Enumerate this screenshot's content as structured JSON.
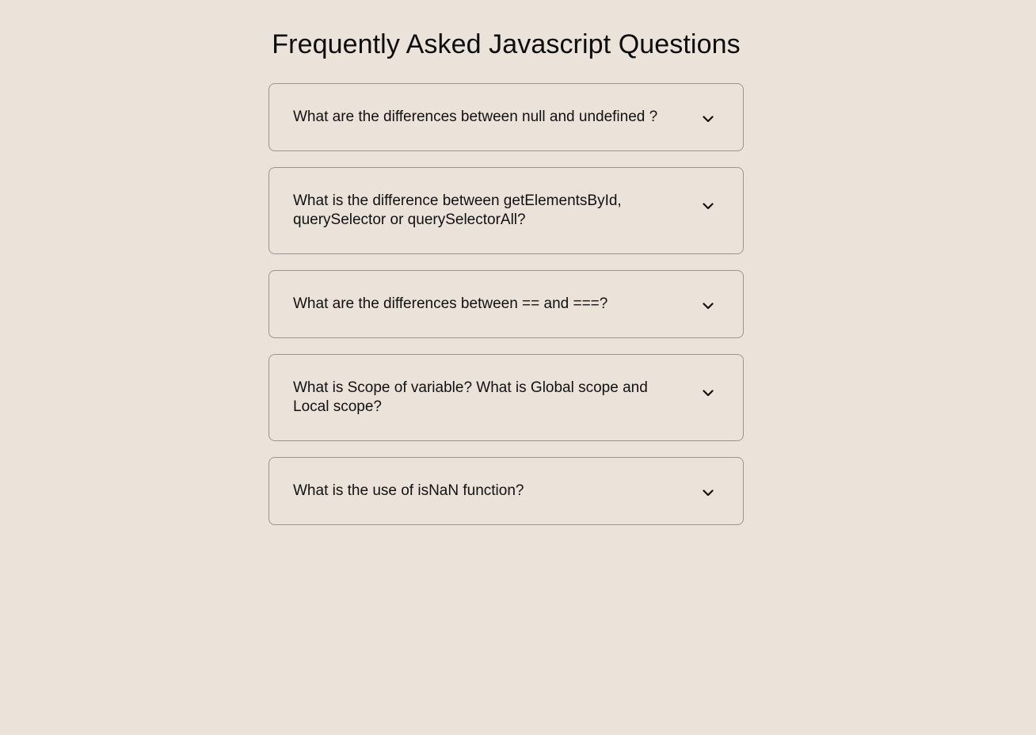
{
  "page": {
    "title": "Frequently Asked Javascript Questions"
  },
  "faq": {
    "items": [
      {
        "question": "What are the differences between null and undefined ?",
        "icon": "chevron-down-icon"
      },
      {
        "question": "What is the difference between getElementsById, querySelector or querySelectorAll?",
        "icon": "chevron-down-icon"
      },
      {
        "question": "What are the differences between == and ===?",
        "icon": "chevron-down-icon"
      },
      {
        "question": "What is Scope of variable? What is Global scope and Local scope?",
        "icon": "chevron-down-icon"
      },
      {
        "question": "What is the use of isNaN function?",
        "icon": "chevron-down-icon"
      }
    ]
  },
  "colors": {
    "background": "#ebe2da",
    "border": "#9a9592",
    "text": "#111111"
  }
}
